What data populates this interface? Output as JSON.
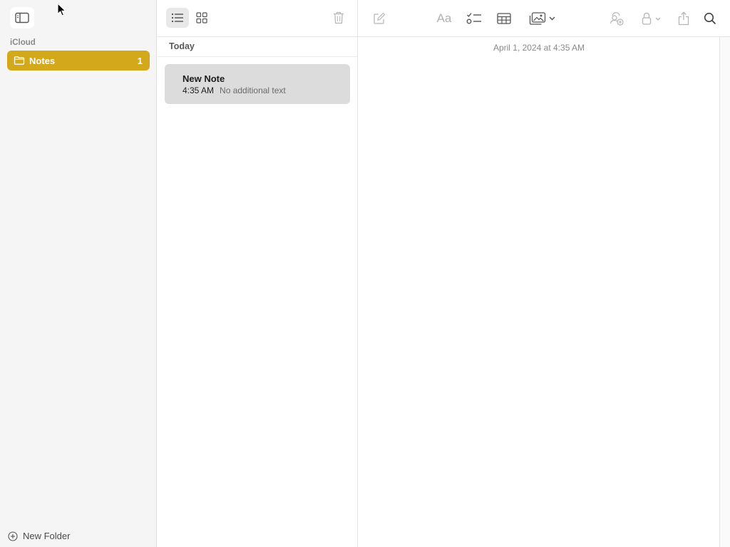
{
  "sidebar": {
    "section_label": "iCloud",
    "folders": [
      {
        "name": "Notes",
        "count": "1"
      }
    ],
    "new_folder_label": "New Folder",
    "accent_color": "#d3a81a"
  },
  "note_list": {
    "group_header": "Today",
    "notes": [
      {
        "title": "New Note",
        "time": "4:35 AM",
        "preview": "No additional text"
      }
    ]
  },
  "editor": {
    "date_line": "April 1, 2024 at 4:35 AM",
    "toolbar_icons": [
      "compose-icon",
      "format-text-icon",
      "checklist-icon",
      "table-icon",
      "media-icon",
      "collaborate-icon",
      "lock-icon",
      "share-icon",
      "search-icon"
    ],
    "format_label": "Aa"
  }
}
